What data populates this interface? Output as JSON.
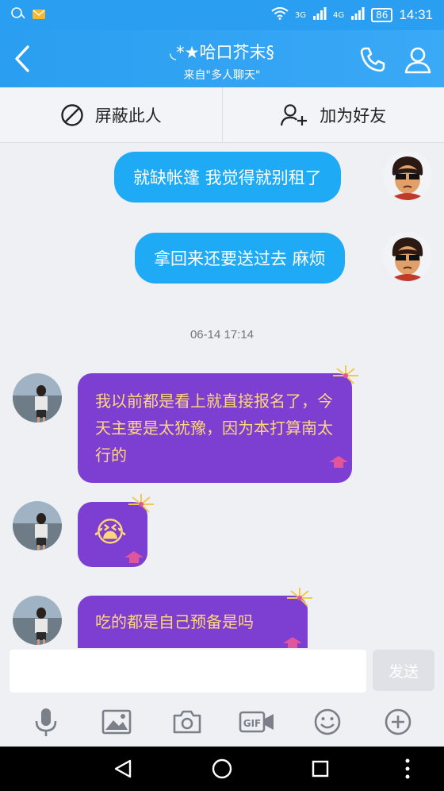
{
  "status": {
    "net1": "3G",
    "net2": "4G",
    "battery": "86",
    "time": "14:31"
  },
  "header": {
    "title": "◟*★哈口芥末§",
    "subtitle": "来自\"多人聊天\""
  },
  "actions": {
    "block_label": "屏蔽此人",
    "add_friend_label": "加为好友"
  },
  "messages": [
    {
      "side": "right",
      "text": "就缺帐篷 我觉得就别租了"
    },
    {
      "side": "right",
      "text": "拿回来还要送过去 麻烦"
    },
    {
      "side": "left",
      "text": "我以前都是看上就直接报名了，今天主要是太犹豫，因为本打算南太行的"
    },
    {
      "side": "left",
      "text": "😭"
    },
    {
      "side": "left",
      "text": "吃的都是自己预备是吗"
    }
  ],
  "timestamp": "06-14 17:14",
  "input": {
    "placeholder": "",
    "send_label": "发送"
  },
  "toolbar_icons": [
    "mic-icon",
    "image-icon",
    "camera-icon",
    "gif-icon",
    "emoji-icon",
    "plus-icon"
  ],
  "colors": {
    "header_blue": "#2a9ef0",
    "bubble_blue": "#1eaaf5",
    "bubble_purple": "#7c3fd2",
    "bubble_purple_text": "#ffd57a"
  }
}
